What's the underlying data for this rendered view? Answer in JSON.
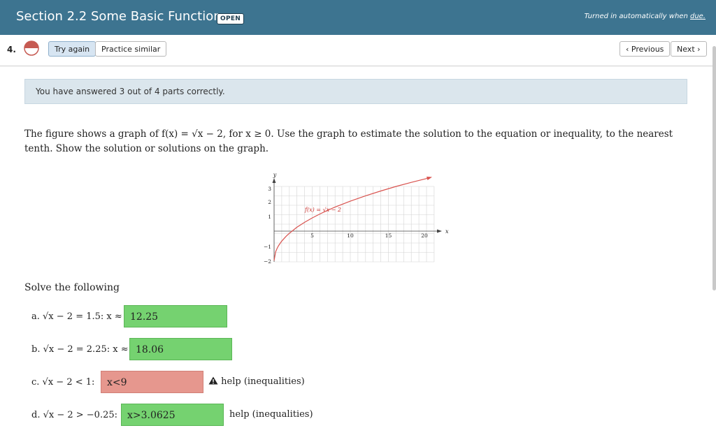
{
  "header": {
    "title": "Section 2.2 Some Basic Functions",
    "badge": "OPEN",
    "turned_prefix": "Turned in automatically when ",
    "turned_link": "due."
  },
  "question": {
    "number": "4.",
    "try_again": "Try again",
    "practice_similar": "Practice similar",
    "previous": "Previous",
    "next": "Next"
  },
  "notice": "You have answered 3 out of 4 parts correctly.",
  "prompt": "The figure shows a graph of f(x) = √x − 2, for x ≥ 0. Use the graph to estimate the solution to the equation or inequality, to the nearest tenth. Show the solution or solutions on the graph.",
  "graph": {
    "ylabel": "y",
    "xlabel": "x",
    "curve_label": "f(x) = √x − 2",
    "x_ticks": [
      "5",
      "10",
      "15",
      "20"
    ],
    "y_ticks": [
      "3",
      "2",
      "1",
      "−1",
      "−2"
    ]
  },
  "solve_label": "Solve the following",
  "parts": [
    {
      "label": "a.  √x − 2 = 1.5: x ≈",
      "answer": "12.25"
    },
    {
      "label": "b.  √x − 2 = 2.25: x ≈",
      "answer": "18.06"
    },
    {
      "label": "c.  √x − 2 < 1:",
      "answer": "x<9",
      "help": "help (inequalities)"
    },
    {
      "label": "d.  √x − 2 > −0.25:",
      "answer": "x>3.0625",
      "help": "help (inequalities)"
    }
  ]
}
